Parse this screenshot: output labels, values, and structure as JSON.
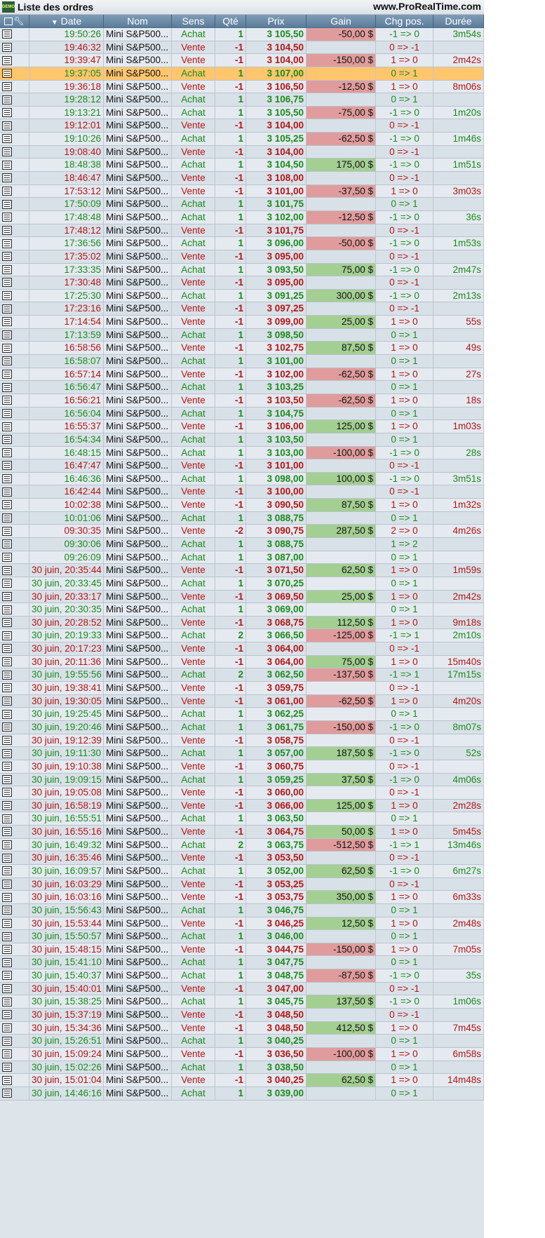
{
  "window": {
    "title": "Liste des ordres",
    "site": "www.ProRealTime.com",
    "logo_text": "DEMO"
  },
  "colors": {
    "buy": "#1a8a1a",
    "sell": "#b31414",
    "selected_row": "#ffc66e",
    "gain_positive": "#a3cf92",
    "gain_negative": "#e09c9c"
  },
  "columns": {
    "date": "Date",
    "name": "Nom",
    "side": "Sens",
    "qty": "Qté",
    "price": "Prix",
    "gain": "Gain",
    "pos_change": "Chg pos.",
    "duration": "Durée",
    "sort_indicator": "▼"
  },
  "rows": [
    {
      "date": "19:50:26",
      "name": "Mini S&P500...",
      "side": "Achat",
      "qty": "1",
      "price": "3 105,50",
      "gain": "-50,00 $",
      "pos": "-1 => 0",
      "dur": "3m54s"
    },
    {
      "date": "19:46:32",
      "name": "Mini S&P500...",
      "side": "Vente",
      "qty": "-1",
      "price": "3 104,50",
      "gain": "",
      "pos": "0 => -1",
      "dur": ""
    },
    {
      "date": "19:39:47",
      "name": "Mini S&P500...",
      "side": "Vente",
      "qty": "-1",
      "price": "3 104,00",
      "gain": "-150,00 $",
      "pos": "1 => 0",
      "dur": "2m42s"
    },
    {
      "date": "19:37:05",
      "name": "Mini S&P500...",
      "side": "Achat",
      "qty": "1",
      "price": "3 107,00",
      "gain": "",
      "pos": "0 => 1",
      "dur": "",
      "selected": true
    },
    {
      "date": "19:36:18",
      "name": "Mini S&P500...",
      "side": "Vente",
      "qty": "-1",
      "price": "3 106,50",
      "gain": "-12,50 $",
      "pos": "1 => 0",
      "dur": "8m06s"
    },
    {
      "date": "19:28:12",
      "name": "Mini S&P500...",
      "side": "Achat",
      "qty": "1",
      "price": "3 106,75",
      "gain": "",
      "pos": "0 => 1",
      "dur": ""
    },
    {
      "date": "19:13:21",
      "name": "Mini S&P500...",
      "side": "Achat",
      "qty": "1",
      "price": "3 105,50",
      "gain": "-75,00 $",
      "pos": "-1 => 0",
      "dur": "1m20s"
    },
    {
      "date": "19:12:01",
      "name": "Mini S&P500...",
      "side": "Vente",
      "qty": "-1",
      "price": "3 104,00",
      "gain": "",
      "pos": "0 => -1",
      "dur": ""
    },
    {
      "date": "19:10:26",
      "name": "Mini S&P500...",
      "side": "Achat",
      "qty": "1",
      "price": "3 105,25",
      "gain": "-62,50 $",
      "pos": "-1 => 0",
      "dur": "1m46s"
    },
    {
      "date": "19:08:40",
      "name": "Mini S&P500...",
      "side": "Vente",
      "qty": "-1",
      "price": "3 104,00",
      "gain": "",
      "pos": "0 => -1",
      "dur": ""
    },
    {
      "date": "18:48:38",
      "name": "Mini S&P500...",
      "side": "Achat",
      "qty": "1",
      "price": "3 104,50",
      "gain": "175,00 $",
      "pos": "-1 => 0",
      "dur": "1m51s"
    },
    {
      "date": "18:46:47",
      "name": "Mini S&P500...",
      "side": "Vente",
      "qty": "-1",
      "price": "3 108,00",
      "gain": "",
      "pos": "0 => -1",
      "dur": ""
    },
    {
      "date": "17:53:12",
      "name": "Mini S&P500...",
      "side": "Vente",
      "qty": "-1",
      "price": "3 101,00",
      "gain": "-37,50 $",
      "pos": "1 => 0",
      "dur": "3m03s"
    },
    {
      "date": "17:50:09",
      "name": "Mini S&P500...",
      "side": "Achat",
      "qty": "1",
      "price": "3 101,75",
      "gain": "",
      "pos": "0 => 1",
      "dur": ""
    },
    {
      "date": "17:48:48",
      "name": "Mini S&P500...",
      "side": "Achat",
      "qty": "1",
      "price": "3 102,00",
      "gain": "-12,50 $",
      "pos": "-1 => 0",
      "dur": "36s"
    },
    {
      "date": "17:48:12",
      "name": "Mini S&P500...",
      "side": "Vente",
      "qty": "-1",
      "price": "3 101,75",
      "gain": "",
      "pos": "0 => -1",
      "dur": ""
    },
    {
      "date": "17:36:56",
      "name": "Mini S&P500...",
      "side": "Achat",
      "qty": "1",
      "price": "3 096,00",
      "gain": "-50,00 $",
      "pos": "-1 => 0",
      "dur": "1m53s"
    },
    {
      "date": "17:35:02",
      "name": "Mini S&P500...",
      "side": "Vente",
      "qty": "-1",
      "price": "3 095,00",
      "gain": "",
      "pos": "0 => -1",
      "dur": ""
    },
    {
      "date": "17:33:35",
      "name": "Mini S&P500...",
      "side": "Achat",
      "qty": "1",
      "price": "3 093,50",
      "gain": "75,00 $",
      "pos": "-1 => 0",
      "dur": "2m47s"
    },
    {
      "date": "17:30:48",
      "name": "Mini S&P500...",
      "side": "Vente",
      "qty": "-1",
      "price": "3 095,00",
      "gain": "",
      "pos": "0 => -1",
      "dur": ""
    },
    {
      "date": "17:25:30",
      "name": "Mini S&P500...",
      "side": "Achat",
      "qty": "1",
      "price": "3 091,25",
      "gain": "300,00 $",
      "pos": "-1 => 0",
      "dur": "2m13s"
    },
    {
      "date": "17:23:16",
      "name": "Mini S&P500...",
      "side": "Vente",
      "qty": "-1",
      "price": "3 097,25",
      "gain": "",
      "pos": "0 => -1",
      "dur": ""
    },
    {
      "date": "17:14:54",
      "name": "Mini S&P500...",
      "side": "Vente",
      "qty": "-1",
      "price": "3 099,00",
      "gain": "25,00 $",
      "pos": "1 => 0",
      "dur": "55s"
    },
    {
      "date": "17:13:59",
      "name": "Mini S&P500...",
      "side": "Achat",
      "qty": "1",
      "price": "3 098,50",
      "gain": "",
      "pos": "0 => 1",
      "dur": ""
    },
    {
      "date": "16:58:56",
      "name": "Mini S&P500...",
      "side": "Vente",
      "qty": "-1",
      "price": "3 102,75",
      "gain": "87,50 $",
      "pos": "1 => 0",
      "dur": "49s"
    },
    {
      "date": "16:58:07",
      "name": "Mini S&P500...",
      "side": "Achat",
      "qty": "1",
      "price": "3 101,00",
      "gain": "",
      "pos": "0 => 1",
      "dur": ""
    },
    {
      "date": "16:57:14",
      "name": "Mini S&P500...",
      "side": "Vente",
      "qty": "-1",
      "price": "3 102,00",
      "gain": "-62,50 $",
      "pos": "1 => 0",
      "dur": "27s"
    },
    {
      "date": "16:56:47",
      "name": "Mini S&P500...",
      "side": "Achat",
      "qty": "1",
      "price": "3 103,25",
      "gain": "",
      "pos": "0 => 1",
      "dur": ""
    },
    {
      "date": "16:56:21",
      "name": "Mini S&P500...",
      "side": "Vente",
      "qty": "-1",
      "price": "3 103,50",
      "gain": "-62,50 $",
      "pos": "1 => 0",
      "dur": "18s"
    },
    {
      "date": "16:56:04",
      "name": "Mini S&P500...",
      "side": "Achat",
      "qty": "1",
      "price": "3 104,75",
      "gain": "",
      "pos": "0 => 1",
      "dur": ""
    },
    {
      "date": "16:55:37",
      "name": "Mini S&P500...",
      "side": "Vente",
      "qty": "-1",
      "price": "3 106,00",
      "gain": "125,00 $",
      "pos": "1 => 0",
      "dur": "1m03s"
    },
    {
      "date": "16:54:34",
      "name": "Mini S&P500...",
      "side": "Achat",
      "qty": "1",
      "price": "3 103,50",
      "gain": "",
      "pos": "0 => 1",
      "dur": ""
    },
    {
      "date": "16:48:15",
      "name": "Mini S&P500...",
      "side": "Achat",
      "qty": "1",
      "price": "3 103,00",
      "gain": "-100,00 $",
      "pos": "-1 => 0",
      "dur": "28s"
    },
    {
      "date": "16:47:47",
      "name": "Mini S&P500...",
      "side": "Vente",
      "qty": "-1",
      "price": "3 101,00",
      "gain": "",
      "pos": "0 => -1",
      "dur": ""
    },
    {
      "date": "16:46:36",
      "name": "Mini S&P500...",
      "side": "Achat",
      "qty": "1",
      "price": "3 098,00",
      "gain": "100,00 $",
      "pos": "-1 => 0",
      "dur": "3m51s"
    },
    {
      "date": "16:42:44",
      "name": "Mini S&P500...",
      "side": "Vente",
      "qty": "-1",
      "price": "3 100,00",
      "gain": "",
      "pos": "0 => -1",
      "dur": ""
    },
    {
      "date": "10:02:38",
      "name": "Mini S&P500...",
      "side": "Vente",
      "qty": "-1",
      "price": "3 090,50",
      "gain": "87,50 $",
      "pos": "1 => 0",
      "dur": "1m32s"
    },
    {
      "date": "10:01:06",
      "name": "Mini S&P500...",
      "side": "Achat",
      "qty": "1",
      "price": "3 088,75",
      "gain": "",
      "pos": "0 => 1",
      "dur": ""
    },
    {
      "date": "09:30:35",
      "name": "Mini S&P500...",
      "side": "Vente",
      "qty": "-2",
      "price": "3 090,75",
      "gain": "287,50 $",
      "pos": "2 => 0",
      "dur": "4m26s"
    },
    {
      "date": "09:30:06",
      "name": "Mini S&P500...",
      "side": "Achat",
      "qty": "1",
      "price": "3 088,75",
      "gain": "",
      "pos": "1 => 2",
      "dur": ""
    },
    {
      "date": "09:26:09",
      "name": "Mini S&P500...",
      "side": "Achat",
      "qty": "1",
      "price": "3 087,00",
      "gain": "",
      "pos": "0 => 1",
      "dur": ""
    },
    {
      "date": "30 juin, 20:35:44",
      "name": "Mini S&P500...",
      "side": "Vente",
      "qty": "-1",
      "price": "3 071,50",
      "gain": "62,50 $",
      "pos": "1 => 0",
      "dur": "1m59s"
    },
    {
      "date": "30 juin, 20:33:45",
      "name": "Mini S&P500...",
      "side": "Achat",
      "qty": "1",
      "price": "3 070,25",
      "gain": "",
      "pos": "0 => 1",
      "dur": ""
    },
    {
      "date": "30 juin, 20:33:17",
      "name": "Mini S&P500...",
      "side": "Vente",
      "qty": "-1",
      "price": "3 069,50",
      "gain": "25,00 $",
      "pos": "1 => 0",
      "dur": "2m42s"
    },
    {
      "date": "30 juin, 20:30:35",
      "name": "Mini S&P500...",
      "side": "Achat",
      "qty": "1",
      "price": "3 069,00",
      "gain": "",
      "pos": "0 => 1",
      "dur": ""
    },
    {
      "date": "30 juin, 20:28:52",
      "name": "Mini S&P500...",
      "side": "Vente",
      "qty": "-1",
      "price": "3 068,75",
      "gain": "112,50 $",
      "pos": "1 => 0",
      "dur": "9m18s"
    },
    {
      "date": "30 juin, 20:19:33",
      "name": "Mini S&P500...",
      "side": "Achat",
      "qty": "2",
      "price": "3 066,50",
      "gain": "-125,00 $",
      "pos": "-1 => 1",
      "dur": "2m10s"
    },
    {
      "date": "30 juin, 20:17:23",
      "name": "Mini S&P500...",
      "side": "Vente",
      "qty": "-1",
      "price": "3 064,00",
      "gain": "",
      "pos": "0 => -1",
      "dur": ""
    },
    {
      "date": "30 juin, 20:11:36",
      "name": "Mini S&P500...",
      "side": "Vente",
      "qty": "-1",
      "price": "3 064,00",
      "gain": "75,00 $",
      "pos": "1 => 0",
      "dur": "15m40s"
    },
    {
      "date": "30 juin, 19:55:56",
      "name": "Mini S&P500...",
      "side": "Achat",
      "qty": "2",
      "price": "3 062,50",
      "gain": "-137,50 $",
      "pos": "-1 => 1",
      "dur": "17m15s"
    },
    {
      "date": "30 juin, 19:38:41",
      "name": "Mini S&P500...",
      "side": "Vente",
      "qty": "-1",
      "price": "3 059,75",
      "gain": "",
      "pos": "0 => -1",
      "dur": ""
    },
    {
      "date": "30 juin, 19:30:05",
      "name": "Mini S&P500...",
      "side": "Vente",
      "qty": "-1",
      "price": "3 061,00",
      "gain": "-62,50 $",
      "pos": "1 => 0",
      "dur": "4m20s"
    },
    {
      "date": "30 juin, 19:25:45",
      "name": "Mini S&P500...",
      "side": "Achat",
      "qty": "1",
      "price": "3 062,25",
      "gain": "",
      "pos": "0 => 1",
      "dur": ""
    },
    {
      "date": "30 juin, 19:20:46",
      "name": "Mini S&P500...",
      "side": "Achat",
      "qty": "1",
      "price": "3 061,75",
      "gain": "-150,00 $",
      "pos": "-1 => 0",
      "dur": "8m07s"
    },
    {
      "date": "30 juin, 19:12:39",
      "name": "Mini S&P500...",
      "side": "Vente",
      "qty": "-1",
      "price": "3 058,75",
      "gain": "",
      "pos": "0 => -1",
      "dur": ""
    },
    {
      "date": "30 juin, 19:11:30",
      "name": "Mini S&P500...",
      "side": "Achat",
      "qty": "1",
      "price": "3 057,00",
      "gain": "187,50 $",
      "pos": "-1 => 0",
      "dur": "52s"
    },
    {
      "date": "30 juin, 19:10:38",
      "name": "Mini S&P500...",
      "side": "Vente",
      "qty": "-1",
      "price": "3 060,75",
      "gain": "",
      "pos": "0 => -1",
      "dur": ""
    },
    {
      "date": "30 juin, 19:09:15",
      "name": "Mini S&P500...",
      "side": "Achat",
      "qty": "1",
      "price": "3 059,25",
      "gain": "37,50 $",
      "pos": "-1 => 0",
      "dur": "4m06s"
    },
    {
      "date": "30 juin, 19:05:08",
      "name": "Mini S&P500...",
      "side": "Vente",
      "qty": "-1",
      "price": "3 060,00",
      "gain": "",
      "pos": "0 => -1",
      "dur": ""
    },
    {
      "date": "30 juin, 16:58:19",
      "name": "Mini S&P500...",
      "side": "Vente",
      "qty": "-1",
      "price": "3 066,00",
      "gain": "125,00 $",
      "pos": "1 => 0",
      "dur": "2m28s"
    },
    {
      "date": "30 juin, 16:55:51",
      "name": "Mini S&P500...",
      "side": "Achat",
      "qty": "1",
      "price": "3 063,50",
      "gain": "",
      "pos": "0 => 1",
      "dur": ""
    },
    {
      "date": "30 juin, 16:55:16",
      "name": "Mini S&P500...",
      "side": "Vente",
      "qty": "-1",
      "price": "3 064,75",
      "gain": "50,00 $",
      "pos": "1 => 0",
      "dur": "5m45s"
    },
    {
      "date": "30 juin, 16:49:32",
      "name": "Mini S&P500...",
      "side": "Achat",
      "qty": "2",
      "price": "3 063,75",
      "gain": "-512,50 $",
      "pos": "-1 => 1",
      "dur": "13m46s"
    },
    {
      "date": "30 juin, 16:35:46",
      "name": "Mini S&P500...",
      "side": "Vente",
      "qty": "-1",
      "price": "3 053,50",
      "gain": "",
      "pos": "0 => -1",
      "dur": ""
    },
    {
      "date": "30 juin, 16:09:57",
      "name": "Mini S&P500...",
      "side": "Achat",
      "qty": "1",
      "price": "3 052,00",
      "gain": "62,50 $",
      "pos": "-1 => 0",
      "dur": "6m27s"
    },
    {
      "date": "30 juin, 16:03:29",
      "name": "Mini S&P500...",
      "side": "Vente",
      "qty": "-1",
      "price": "3 053,25",
      "gain": "",
      "pos": "0 => -1",
      "dur": ""
    },
    {
      "date": "30 juin, 16:03:16",
      "name": "Mini S&P500...",
      "side": "Vente",
      "qty": "-1",
      "price": "3 053,75",
      "gain": "350,00 $",
      "pos": "1 => 0",
      "dur": "6m33s"
    },
    {
      "date": "30 juin, 15:56:43",
      "name": "Mini S&P500...",
      "side": "Achat",
      "qty": "1",
      "price": "3 046,75",
      "gain": "",
      "pos": "0 => 1",
      "dur": ""
    },
    {
      "date": "30 juin, 15:53:44",
      "name": "Mini S&P500...",
      "side": "Vente",
      "qty": "-1",
      "price": "3 046,25",
      "gain": "12,50 $",
      "pos": "1 => 0",
      "dur": "2m48s"
    },
    {
      "date": "30 juin, 15:50:57",
      "name": "Mini S&P500...",
      "side": "Achat",
      "qty": "1",
      "price": "3 046,00",
      "gain": "",
      "pos": "0 => 1",
      "dur": ""
    },
    {
      "date": "30 juin, 15:48:15",
      "name": "Mini S&P500...",
      "side": "Vente",
      "qty": "-1",
      "price": "3 044,75",
      "gain": "-150,00 $",
      "pos": "1 => 0",
      "dur": "7m05s"
    },
    {
      "date": "30 juin, 15:41:10",
      "name": "Mini S&P500...",
      "side": "Achat",
      "qty": "1",
      "price": "3 047,75",
      "gain": "",
      "pos": "0 => 1",
      "dur": ""
    },
    {
      "date": "30 juin, 15:40:37",
      "name": "Mini S&P500...",
      "side": "Achat",
      "qty": "1",
      "price": "3 048,75",
      "gain": "-87,50 $",
      "pos": "-1 => 0",
      "dur": "35s"
    },
    {
      "date": "30 juin, 15:40:01",
      "name": "Mini S&P500...",
      "side": "Vente",
      "qty": "-1",
      "price": "3 047,00",
      "gain": "",
      "pos": "0 => -1",
      "dur": ""
    },
    {
      "date": "30 juin, 15:38:25",
      "name": "Mini S&P500...",
      "side": "Achat",
      "qty": "1",
      "price": "3 045,75",
      "gain": "137,50 $",
      "pos": "-1 => 0",
      "dur": "1m06s"
    },
    {
      "date": "30 juin, 15:37:19",
      "name": "Mini S&P500...",
      "side": "Vente",
      "qty": "-1",
      "price": "3 048,50",
      "gain": "",
      "pos": "0 => -1",
      "dur": ""
    },
    {
      "date": "30 juin, 15:34:36",
      "name": "Mini S&P500...",
      "side": "Vente",
      "qty": "-1",
      "price": "3 048,50",
      "gain": "412,50 $",
      "pos": "1 => 0",
      "dur": "7m45s"
    },
    {
      "date": "30 juin, 15:26:51",
      "name": "Mini S&P500...",
      "side": "Achat",
      "qty": "1",
      "price": "3 040,25",
      "gain": "",
      "pos": "0 => 1",
      "dur": ""
    },
    {
      "date": "30 juin, 15:09:24",
      "name": "Mini S&P500...",
      "side": "Vente",
      "qty": "-1",
      "price": "3 036,50",
      "gain": "-100,00 $",
      "pos": "1 => 0",
      "dur": "6m58s"
    },
    {
      "date": "30 juin, 15:02:26",
      "name": "Mini S&P500...",
      "side": "Achat",
      "qty": "1",
      "price": "3 038,50",
      "gain": "",
      "pos": "0 => 1",
      "dur": ""
    },
    {
      "date": "30 juin, 15:01:04",
      "name": "Mini S&P500...",
      "side": "Vente",
      "qty": "-1",
      "price": "3 040,25",
      "gain": "62,50 $",
      "pos": "1 => 0",
      "dur": "14m48s"
    },
    {
      "date": "30 juin, 14:46:16",
      "name": "Mini S&P500...",
      "side": "Achat",
      "qty": "1",
      "price": "3 039,00",
      "gain": "",
      "pos": "0 => 1",
      "dur": ""
    }
  ]
}
